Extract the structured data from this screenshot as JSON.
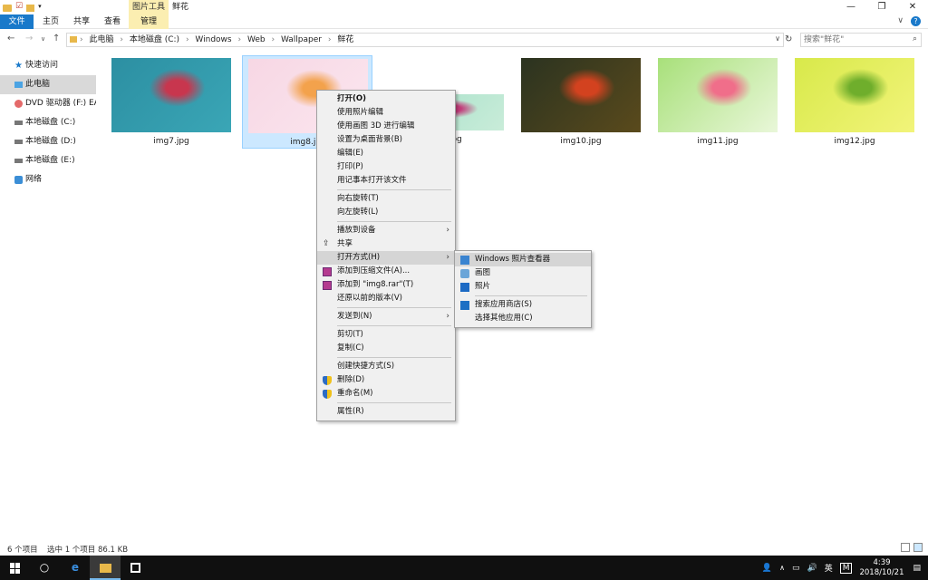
{
  "window": {
    "title": "鲜花",
    "contextual_tab_group": "图片工具",
    "controls": {
      "minimize": "—",
      "maximize": "❐",
      "close": "✕"
    }
  },
  "ribbon": {
    "tabs": [
      "文件",
      "主页",
      "共享",
      "查看",
      "管理"
    ],
    "expand_icon": "∨",
    "help_icon": "?"
  },
  "address": {
    "crumbs": [
      "此电脑",
      "本地磁盘 (C:)",
      "Windows",
      "Web",
      "Wallpaper",
      "鲜花"
    ],
    "separator": "›"
  },
  "search": {
    "placeholder": "搜索\"鲜花\""
  },
  "sidebar": {
    "items": [
      {
        "label": "快速访问",
        "icon": "star-icon"
      },
      {
        "label": "此电脑",
        "icon": "pc-icon"
      },
      {
        "label": "DVD 驱动器 (F:) EAS",
        "icon": "dvd-icon"
      },
      {
        "label": "本地磁盘 (C:)",
        "icon": "drive-icon"
      },
      {
        "label": "本地磁盘 (D:)",
        "icon": "drive-icon"
      },
      {
        "label": "本地磁盘 (E:)",
        "icon": "drive-icon"
      },
      {
        "label": "网络",
        "icon": "network-icon"
      }
    ]
  },
  "files": [
    {
      "name": "img7.jpg",
      "colors": [
        "#2c8fa2",
        "#3aa6b6",
        "#c8364e"
      ]
    },
    {
      "name": "img8.jpg",
      "colors": [
        "#f7d7e4",
        "#fbe6ef",
        "#f3a24c"
      ]
    },
    {
      "name": "img9.jpg",
      "colors": [
        "#a3e0c8",
        "#c9ecd9",
        "#c23c7a"
      ]
    },
    {
      "name": "img10.jpg",
      "colors": [
        "#2b3320",
        "#5a4a1c",
        "#d3421f"
      ]
    },
    {
      "name": "img11.jpg",
      "colors": [
        "#a8e07a",
        "#e9f7d9",
        "#f06e8a"
      ]
    },
    {
      "name": "img12.jpg",
      "colors": [
        "#d8e94a",
        "#f2f47a",
        "#6fae2c"
      ]
    }
  ],
  "context_menu": {
    "items": [
      {
        "label": "打开(O)",
        "bold": true
      },
      {
        "label": "使用照片编辑"
      },
      {
        "label": "使用画图 3D 进行编辑"
      },
      {
        "label": "设置为桌面背景(B)"
      },
      {
        "label": "编辑(E)"
      },
      {
        "label": "打印(P)"
      },
      {
        "label": "用记事本打开该文件"
      },
      {
        "sep": true
      },
      {
        "label": "向右旋转(T)"
      },
      {
        "label": "向左旋转(L)"
      },
      {
        "sep": true
      },
      {
        "label": "播放到设备",
        "arrow": true
      },
      {
        "label": "共享",
        "icon": "share-icon"
      },
      {
        "label": "打开方式(H)",
        "arrow": true,
        "hover": true
      },
      {
        "label": "添加到压缩文件(A)...",
        "icon": "rar-icon"
      },
      {
        "label": "添加到 \"img8.rar\"(T)",
        "icon": "rar-icon"
      },
      {
        "label": "还原以前的版本(V)"
      },
      {
        "sep": true
      },
      {
        "label": "发送到(N)",
        "arrow": true
      },
      {
        "sep": true
      },
      {
        "label": "剪切(T)"
      },
      {
        "label": "复制(C)"
      },
      {
        "sep": true
      },
      {
        "label": "创建快捷方式(S)"
      },
      {
        "label": "删除(D)",
        "icon": "shield-icon"
      },
      {
        "label": "重命名(M)",
        "icon": "shield-icon"
      },
      {
        "sep": true
      },
      {
        "label": "属性(R)"
      }
    ]
  },
  "open_with_menu": {
    "items": [
      {
        "label": "Windows 照片查看器",
        "icon": "photo-viewer-icon",
        "hover": true
      },
      {
        "label": "画图",
        "icon": "paint-icon"
      },
      {
        "label": "照片",
        "icon": "photos-icon"
      },
      {
        "sep": true
      },
      {
        "label": "搜索应用商店(S)",
        "icon": "store-icon"
      },
      {
        "label": "选择其他应用(C)"
      }
    ]
  },
  "status": {
    "count": "6 个项目",
    "selection": "选中 1 个项目  86.1 KB"
  },
  "taskbar": {
    "tray_lang": "英",
    "tray_ime": "M",
    "time": "4:39",
    "date": "2018/10/21"
  }
}
